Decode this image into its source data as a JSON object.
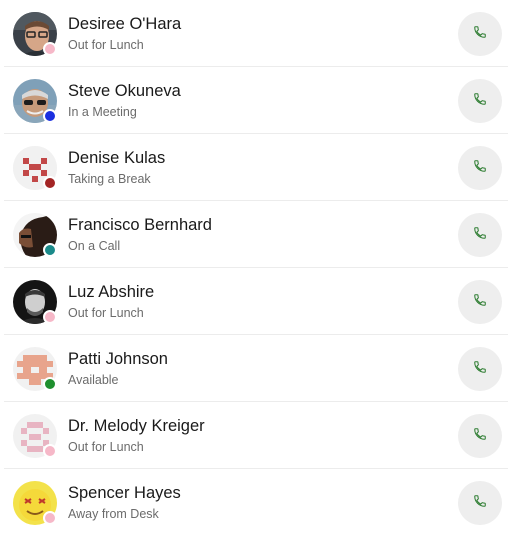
{
  "colors": {
    "call_icon": "#2e7d32",
    "call_button_bg": "#eeeeee",
    "status_out_for_lunch": "#f6b8c8",
    "status_in_meeting": "#1a2fe0",
    "status_taking_break": "#a32525",
    "status_on_call": "#1a8a8a",
    "status_available": "#1e8f2e"
  },
  "contacts": [
    {
      "name": "Desiree O'Hara",
      "status": "Out for Lunch",
      "status_color": "#f6b8c8",
      "avatar": "photo-man-glasses"
    },
    {
      "name": "Steve Okuneva",
      "status": "In a Meeting",
      "status_color": "#1a2fe0",
      "avatar": "photo-man-sunglasses"
    },
    {
      "name": "Denise Kulas",
      "status": "Taking a Break",
      "status_color": "#a32525",
      "avatar": "identicon-red"
    },
    {
      "name": "Francisco Bernhard",
      "status": "On a Call",
      "status_color": "#1a8a8a",
      "avatar": "photo-man-profile"
    },
    {
      "name": "Luz Abshire",
      "status": "Out for Lunch",
      "status_color": "#f6b8c8",
      "avatar": "photo-man-dark"
    },
    {
      "name": "Patti Johnson",
      "status": "Available",
      "status_color": "#1e8f2e",
      "avatar": "identicon-salmon"
    },
    {
      "name": "Dr. Melody Kreiger",
      "status": "Out for Lunch",
      "status_color": "#f6b8c8",
      "avatar": "identicon-pink"
    },
    {
      "name": "Spencer Hayes",
      "status": "Away from Desk",
      "status_color": "#f6b8c8",
      "avatar": "emoji-yellow"
    }
  ]
}
